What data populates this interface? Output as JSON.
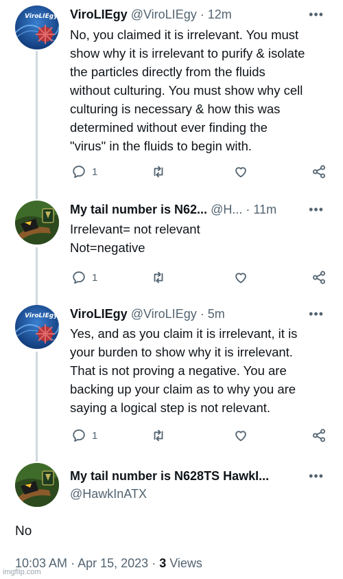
{
  "tweets": [
    {
      "name": "ViroLIEgy",
      "handle": "@ViroLIEgy",
      "time": "12m",
      "lines": [
        "No, you claimed it is irrelevant. You must",
        "show why it is irrelevant to purify & isolate",
        "the particles directly from the fluids",
        "without culturing. You must show why cell",
        "culturing is necessary & how this was",
        "determined without ever finding the",
        "\"virus\" in the fluids to begin with."
      ],
      "reply_count": "1"
    },
    {
      "name": "My tail number is N62...",
      "handle": "@H...",
      "time": "11m",
      "lines": [
        "Irrelevant= not relevant",
        "Not=negative"
      ],
      "reply_count": "1"
    },
    {
      "name": "ViroLIEgy",
      "handle": "@ViroLIEgy",
      "time": "5m",
      "lines": [
        "Yes, and as you claim it is irrelevant, it is",
        "your burden to show why it is irrelevant.",
        "That is not proving a negative. You are",
        "backing up your claim as to why you are",
        "saying a logical step is not relevant."
      ],
      "reply_count": "1"
    }
  ],
  "main_tweet": {
    "name": "My tail number is N628TS HawkI...",
    "handle": "@HawkInATX",
    "text": "No",
    "time": "10:03 AM",
    "date": "Apr 15, 2023",
    "views_count": "3",
    "views_label": "Views"
  },
  "avatar_label_viro": "ViroLIEgy",
  "separator": "·",
  "more_glyph": "•••",
  "watermark": "imgflip.com",
  "colors": {
    "text": "#0f1419",
    "secondary": "#536471",
    "line": "#cfd9de"
  },
  "icons": [
    "reply-icon",
    "retweet-icon",
    "like-icon",
    "share-icon",
    "more-icon"
  ]
}
